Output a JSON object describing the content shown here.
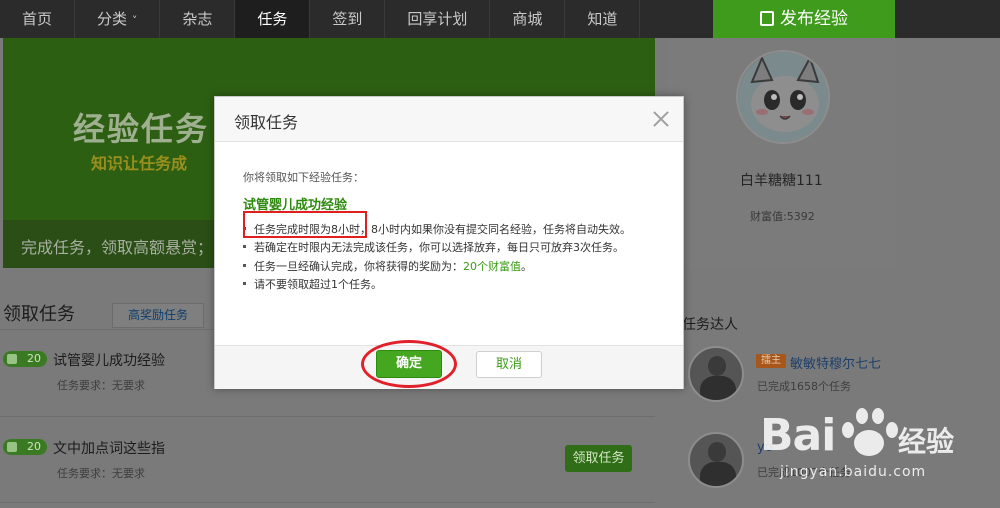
{
  "nav": {
    "items": [
      "首页",
      "分类",
      "杂志",
      "任务",
      "签到",
      "回享计划",
      "商城",
      "知道"
    ],
    "dropdown_marker": "˅",
    "publish_label": "发布经验"
  },
  "banner": {
    "title": "经验任务",
    "subtitle": "知识让任务成",
    "tagline": "完成任务，领取高额悬赏；"
  },
  "profile": {
    "name": "白羊糖糖111",
    "wealth": "财富值:5392"
  },
  "tasks_section": {
    "title": "领取任务",
    "tab": "高奖励任务",
    "claim_label": "领取任务",
    "rows": [
      {
        "reward": "20",
        "title": "试管婴儿成功经验",
        "req": "任务要求：无要求"
      },
      {
        "reward": "20",
        "title": "文中加点词这些指",
        "req": "任务要求：无要求"
      }
    ]
  },
  "masters": {
    "title": "任务达人",
    "tag": "擂主",
    "list": [
      {
        "name": "敏敏特穆尔七七",
        "done": "已完成1658个任务"
      },
      {
        "name": "yo",
        "done": "已完成1007个任务"
      }
    ]
  },
  "watermark": {
    "url": "jingyan.baidu.com"
  },
  "modal": {
    "title": "领取任务",
    "intro": "你将领取如下经验任务：",
    "task_name": "试管婴儿成功经验",
    "rule1_a": "任务完成时限为8小时，",
    "rule1_b": "8小时内如果你没有提交同名经验，任务将自动失效。",
    "rule2": "若确定在时限内无法完成该任务，你可以选择放弃，每日只可放弃3次任务。",
    "rule3_a": "任务一旦经确认完成，你将获得的奖励为：",
    "rule3_b": "20个财富值",
    "rule3_c": "。",
    "rule4": "请不要领取超过1个任务。",
    "ok_label": "确定",
    "cancel_label": "取消"
  },
  "colors": {
    "accent_green": "#3f9b1c",
    "annotation_red": "#e02020"
  }
}
